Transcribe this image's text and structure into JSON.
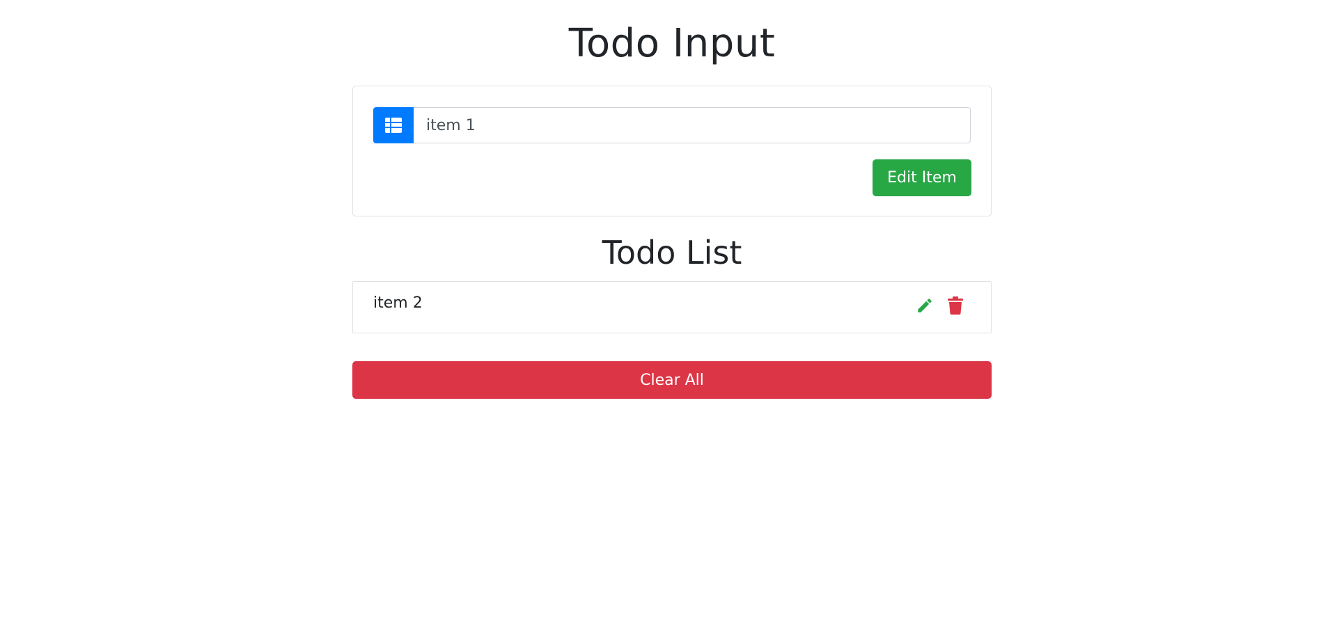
{
  "page": {
    "title": "Todo Input",
    "list_title": "Todo List"
  },
  "form": {
    "input_value": "item 1",
    "addon_icon": "table-list-icon",
    "submit_label": "Edit Item"
  },
  "todo_items": [
    {
      "text": "item 2",
      "edit_icon": "pencil-icon",
      "delete_icon": "trash-icon"
    }
  ],
  "footer": {
    "clear_label": "Clear All"
  },
  "colors": {
    "primary": "#007bff",
    "success": "#28a745",
    "danger": "#dc3545",
    "text": "#212529"
  }
}
